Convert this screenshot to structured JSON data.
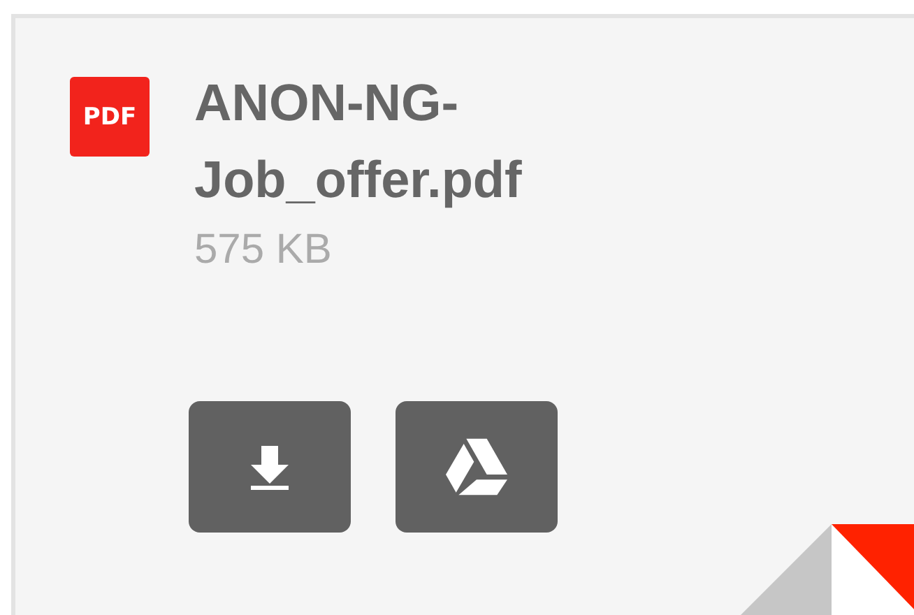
{
  "attachment": {
    "type_label": "PDF",
    "name": "ANON-NG-Job_offer.pdf",
    "size": "575 KB",
    "actions": [
      {
        "kind": "download"
      },
      {
        "kind": "drive"
      }
    ]
  }
}
